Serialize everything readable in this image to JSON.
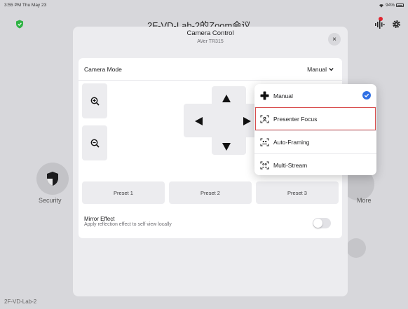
{
  "status_bar": {
    "time": "3:55 PM  Thu May 23",
    "battery": "94%"
  },
  "background": {
    "meeting_title": "2F-VD-Lab-2的Zoom会议",
    "security_label": "Security",
    "more_label": "More",
    "room_name": "2F-VD-Lab-2"
  },
  "modal": {
    "title": "Camera Control",
    "subtitle": "AVer TR315",
    "close_glyph": "×",
    "camera_mode_label": "Camera Mode",
    "camera_mode_value": "Manual",
    "presets": [
      "Preset 1",
      "Preset 2",
      "Preset 3"
    ],
    "mirror_title": "Mirror Effect",
    "mirror_description": "Apply reflection effect to self view locally",
    "mirror_enabled": false
  },
  "dropdown": {
    "items": [
      {
        "label": "Manual",
        "icon": "move-icon",
        "selected": true
      },
      {
        "label": "Presenter Focus",
        "icon": "presenter-focus-icon",
        "selected": false,
        "highlighted": true
      },
      {
        "label": "Auto-Framing",
        "icon": "auto-framing-icon",
        "selected": false
      },
      {
        "label": "Multi-Stream",
        "icon": "multi-stream-icon",
        "selected": false
      }
    ]
  },
  "colors": {
    "accent": "#2f6fe4",
    "highlight": "#d84c4c",
    "recording": "#e0242f",
    "shield": "#2fb344"
  }
}
